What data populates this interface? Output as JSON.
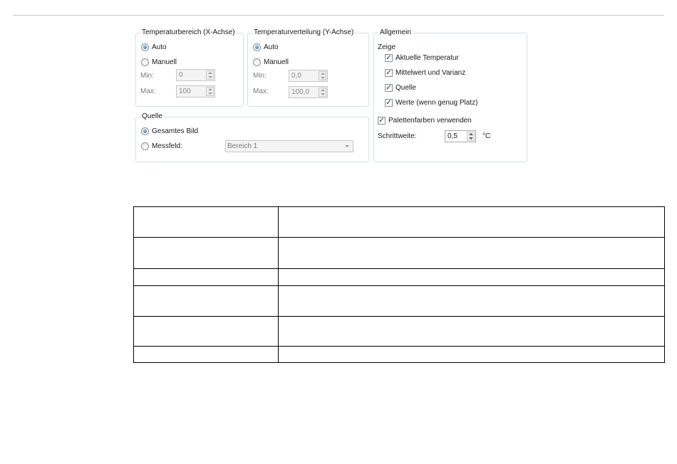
{
  "panels": {
    "x_axis": {
      "legend": "Temperaturbereich (X-Achse)",
      "auto": "Auto",
      "manuell": "Manuell",
      "min_label": "Min:",
      "min_value": "0",
      "max_label": "Max:",
      "max_value": "100"
    },
    "y_axis": {
      "legend": "Temperaturverteilung (Y-Achse)",
      "auto": "Auto",
      "manuell": "Manuell",
      "min_label": "Min:",
      "min_value": "0,0",
      "max_label": "Max:",
      "max_value": "100,0"
    },
    "quelle": {
      "legend": "Quelle",
      "gesamtes_bild": "Gesamtes Bild",
      "messfeld": "Messfeld:",
      "messfeld_value": "Bereich 1"
    },
    "allgemein": {
      "legend": "Allgemein",
      "zeige": "Zeige",
      "aktuelle_temperatur": "Aktuelle Temperatur",
      "mittelwert": "Mittelwert und Varianz",
      "quelle": "Quelle",
      "werte": "Werte (wenn genug Platz)",
      "palettenfarben": "Palettenfarben verwenden",
      "schrittweite_label": "Schrittweite:",
      "schrittweite_value": "0,5",
      "unit": "°C"
    }
  },
  "state": {
    "x_axis_mode": "Auto",
    "y_axis_mode": "Auto",
    "quelle_mode": "Gesamtes Bild",
    "checks": {
      "aktuelle_temperatur": true,
      "mittelwert": true,
      "quelle": true,
      "werte": true,
      "palettenfarben": true
    }
  },
  "icons": {
    "spinner": "up-down-arrows-icon",
    "dropdown": "chevron-down-icon",
    "check": "checkmark-icon"
  },
  "colors": {
    "panel_border": "#d5dfe5",
    "radio_selected": "#1e5d99",
    "disabled_text": "#7a7a7a"
  },
  "table": {
    "rows": [
      [
        "",
        ""
      ],
      [
        "",
        ""
      ],
      [
        "",
        ""
      ],
      [
        "",
        ""
      ],
      [
        "",
        ""
      ],
      [
        "",
        ""
      ]
    ]
  }
}
